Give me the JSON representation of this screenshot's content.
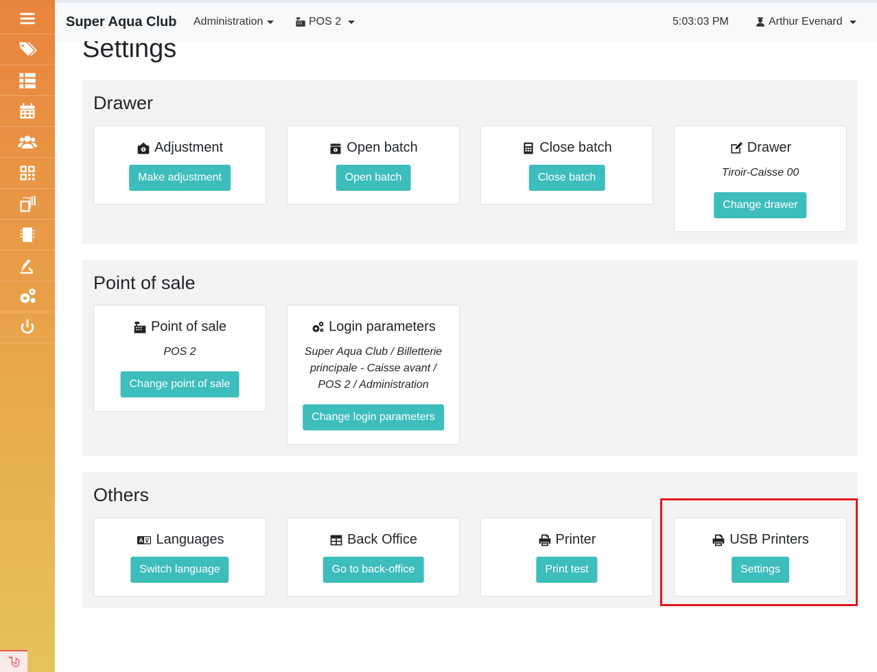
{
  "app": {
    "brand": "Super Aqua Club",
    "time": "5:03:03 PM",
    "user": "Arthur Evenard"
  },
  "nav": {
    "administration": "Administration",
    "pos": "POS 2"
  },
  "sidebar": {
    "items": [
      "menu-icon",
      "tags-icon",
      "list-icon",
      "calendar-icon",
      "users-icon",
      "qrcode-icon",
      "barcode-icon",
      "chip-icon",
      "edit-icon",
      "settings-icon",
      "power-icon"
    ]
  },
  "page": {
    "title": "Settings"
  },
  "sections": {
    "drawer": {
      "title": "Drawer",
      "adjustment": {
        "title": "Adjustment",
        "button": "Make adjustment"
      },
      "open_batch": {
        "title": "Open batch",
        "button": "Open batch"
      },
      "close_batch": {
        "title": "Close batch",
        "button": "Close batch"
      },
      "drawer": {
        "title": "Drawer",
        "value": "Tiroir-Caisse 00",
        "button": "Change drawer"
      }
    },
    "pos": {
      "title": "Point of sale",
      "point_of_sale": {
        "title": "Point of sale",
        "value": "POS 2",
        "button": "Change point of sale"
      },
      "login": {
        "title": "Login parameters",
        "line1": "Super Aqua Club / Billetterie",
        "line2": "principale - Caisse avant /",
        "line3": "POS 2 / Administration",
        "button": "Change login parameters"
      }
    },
    "others": {
      "title": "Others",
      "languages": {
        "title": "Languages",
        "button": "Switch language"
      },
      "back_office": {
        "title": "Back Office",
        "button": "Go to back-office"
      },
      "printer": {
        "title": "Printer",
        "button": "Print test"
      },
      "usb_printers": {
        "title": "USB Printers",
        "button": "Settings"
      }
    }
  },
  "colors": {
    "accent": "#3dbdbb",
    "sidebar_top": "#e9843c",
    "sidebar_bottom": "#e6c35a",
    "highlight": "#e0161b"
  }
}
